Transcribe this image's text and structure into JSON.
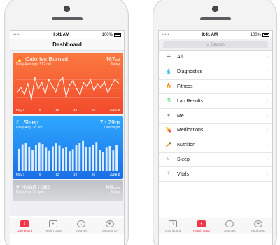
{
  "left": {
    "status": {
      "carrier": "•••••",
      "time": "9:41 AM",
      "battery": "100%"
    },
    "nav_title": "Dashboard",
    "cards": [
      {
        "title": "Calories Burned",
        "value": "467",
        "unit": "cal",
        "subtitle": "Daily Average: 512 cal",
        "when": "Today",
        "x_labels": [
          "May 1",
          "5",
          "12",
          "19",
          "26",
          "June 2"
        ],
        "color": "#f45a31"
      },
      {
        "title": "Sleep",
        "value": "7h 29m",
        "unit": "",
        "subtitle": "Daily Avg: 7h 5m",
        "when": "Last Night",
        "x_labels": [
          "May 1",
          "5",
          "12",
          "19",
          "26",
          "June 2"
        ],
        "color": "#2487f1"
      },
      {
        "title": "Heart Rate",
        "value": "68",
        "unit": "bpm",
        "subtitle": "Daily Avg: 70 bpm",
        "when": "Today",
        "color": "#c7c9cc"
      }
    ],
    "tabs": [
      {
        "label": "Dashboard",
        "icon": "dashboard-icon",
        "active": true
      },
      {
        "label": "Health Data",
        "icon": "health-data-icon",
        "active": false
      },
      {
        "label": "Sources",
        "icon": "sources-icon",
        "active": false
      },
      {
        "label": "Medical ID",
        "icon": "medical-id-icon",
        "active": false
      }
    ]
  },
  "right": {
    "status": {
      "carrier": "•••••",
      "time": "9:41 AM",
      "battery": "100%"
    },
    "search_placeholder": "Search",
    "categories": [
      {
        "label": "All",
        "icon": "list-icon",
        "color": "#4a4a4f"
      },
      {
        "label": "Diagnostics",
        "icon": "drop-icon",
        "color": "#5ac8fa"
      },
      {
        "label": "Fitness",
        "icon": "flame-icon",
        "color": "#ff3b30"
      },
      {
        "label": "Lab Results",
        "icon": "flask-icon",
        "color": "#4cd964"
      },
      {
        "label": "Me",
        "icon": "person-icon",
        "color": "#8e8e93"
      },
      {
        "label": "Medications",
        "icon": "pill-icon",
        "color": "#ffcc00"
      },
      {
        "label": "Nutrition",
        "icon": "carrot-icon",
        "color": "#ff9500"
      },
      {
        "label": "Sleep",
        "icon": "moon-icon",
        "color": "#1a5fe0"
      },
      {
        "label": "Vitals",
        "icon": "stethoscope-icon",
        "color": "#8e8e93"
      }
    ],
    "tabs": [
      {
        "label": "Dashboard",
        "icon": "dashboard-icon",
        "active": false
      },
      {
        "label": "Health Data",
        "icon": "health-data-icon",
        "active": true
      },
      {
        "label": "Sources",
        "icon": "sources-icon",
        "active": false
      },
      {
        "label": "Medical ID",
        "icon": "medical-id-icon",
        "active": false
      }
    ]
  },
  "chart_data": [
    {
      "type": "line",
      "title": "Calories Burned",
      "values": [
        380,
        420,
        350,
        460,
        300,
        520,
        410,
        470,
        360,
        500,
        440,
        380,
        480,
        520,
        330,
        450,
        490,
        410,
        350,
        470,
        430,
        500,
        390,
        460,
        420,
        480,
        370,
        440,
        500,
        467
      ]
    },
    {
      "type": "bar",
      "title": "Sleep",
      "values": [
        6.5,
        7.8,
        8.2,
        7.1,
        6.2,
        7.5,
        8.4,
        7.9,
        6.8,
        5.9,
        7.2,
        8.1,
        7.4,
        6.6,
        7.0,
        5.8,
        6.4,
        7.6,
        8.3,
        8.8,
        7.1,
        6.9,
        7.7,
        8.5,
        6.1,
        5.5,
        6.8,
        7.3,
        6.0,
        7.5
      ]
    }
  ]
}
